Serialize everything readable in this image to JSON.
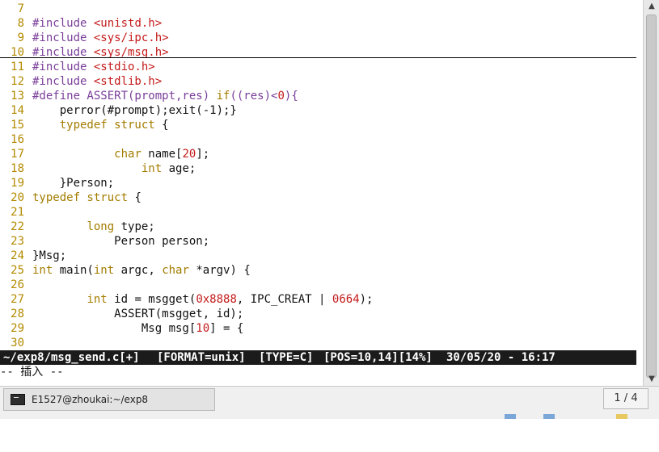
{
  "editor": {
    "lines": [
      {
        "num": "7",
        "segs": []
      },
      {
        "num": "8",
        "segs": [
          {
            "t": "#include ",
            "c": "pp"
          },
          {
            "t": "<",
            "c": "str"
          },
          {
            "t": "unistd.h",
            "c": "str"
          },
          {
            "t": ">",
            "c": "str"
          }
        ]
      },
      {
        "num": "9",
        "segs": [
          {
            "t": "#include ",
            "c": "pp"
          },
          {
            "t": "<sys/ipc.h>",
            "c": "str"
          }
        ]
      },
      {
        "num": "10",
        "segs": [
          {
            "t": "#include ",
            "c": "pp"
          },
          {
            "t": "<sys/msg.h>",
            "c": "str"
          }
        ]
      },
      {
        "num": "11",
        "segs": [
          {
            "t": "#include ",
            "c": "pp"
          },
          {
            "t": "<stdio.h>",
            "c": "str"
          }
        ]
      },
      {
        "num": "12",
        "segs": [
          {
            "t": "#include ",
            "c": "pp"
          },
          {
            "t": "<stdlib.h>",
            "c": "str"
          }
        ]
      },
      {
        "num": "13",
        "segs": [
          {
            "t": "#define ASSERT(prompt,res) ",
            "c": "pp"
          },
          {
            "t": "if",
            "c": "kw"
          },
          {
            "t": "((res)<",
            "c": "pp"
          },
          {
            "t": "0",
            "c": "num"
          },
          {
            "t": "){",
            "c": "pp"
          }
        ]
      },
      {
        "num": "14",
        "segs": [
          {
            "t": "    perror(#prompt);exit(-1);}",
            "c": "op"
          }
        ]
      },
      {
        "num": "15",
        "segs": [
          {
            "t": "    ",
            "c": "op"
          },
          {
            "t": "typedef struct",
            "c": "kw"
          },
          {
            "t": " {",
            "c": "op"
          }
        ]
      },
      {
        "num": "16",
        "segs": []
      },
      {
        "num": "17",
        "segs": [
          {
            "t": "            ",
            "c": "op"
          },
          {
            "t": "char",
            "c": "kw"
          },
          {
            "t": " name[",
            "c": "op"
          },
          {
            "t": "20",
            "c": "num"
          },
          {
            "t": "];",
            "c": "op"
          }
        ]
      },
      {
        "num": "18",
        "segs": [
          {
            "t": "                ",
            "c": "op"
          },
          {
            "t": "int",
            "c": "kw"
          },
          {
            "t": " age;",
            "c": "op"
          }
        ]
      },
      {
        "num": "19",
        "segs": [
          {
            "t": "    }Person;",
            "c": "op"
          }
        ]
      },
      {
        "num": "20",
        "segs": [
          {
            "t": "typedef struct",
            "c": "kw"
          },
          {
            "t": " {",
            "c": "op"
          }
        ]
      },
      {
        "num": "21",
        "segs": []
      },
      {
        "num": "22",
        "segs": [
          {
            "t": "        ",
            "c": "op"
          },
          {
            "t": "long",
            "c": "kw"
          },
          {
            "t": " type;",
            "c": "op"
          }
        ]
      },
      {
        "num": "23",
        "segs": [
          {
            "t": "            Person person;",
            "c": "op"
          }
        ]
      },
      {
        "num": "24",
        "segs": [
          {
            "t": "}Msg;",
            "c": "op"
          }
        ]
      },
      {
        "num": "25",
        "segs": [
          {
            "t": "int",
            "c": "kw"
          },
          {
            "t": " main(",
            "c": "op"
          },
          {
            "t": "int",
            "c": "kw"
          },
          {
            "t": " argc, ",
            "c": "op"
          },
          {
            "t": "char",
            "c": "kw"
          },
          {
            "t": " *argv) {",
            "c": "op"
          }
        ]
      },
      {
        "num": "26",
        "segs": []
      },
      {
        "num": "27",
        "segs": [
          {
            "t": "        ",
            "c": "op"
          },
          {
            "t": "int",
            "c": "kw"
          },
          {
            "t": " id = msgget(",
            "c": "op"
          },
          {
            "t": "0x8888",
            "c": "num"
          },
          {
            "t": ", IPC_CREAT | ",
            "c": "op"
          },
          {
            "t": "0664",
            "c": "num"
          },
          {
            "t": ");",
            "c": "op"
          }
        ]
      },
      {
        "num": "28",
        "segs": [
          {
            "t": "            ASSERT(msgget, id);",
            "c": "op"
          }
        ]
      },
      {
        "num": "29",
        "segs": [
          {
            "t": "                Msg msg[",
            "c": "op"
          },
          {
            "t": "10",
            "c": "num"
          },
          {
            "t": "] = {",
            "c": "op"
          }
        ]
      },
      {
        "num": "30",
        "segs": []
      }
    ]
  },
  "statusbar": {
    "file": "~/exp8/msg_send.c[+]",
    "format": "[FORMAT=unix]",
    "type": "[TYPE=C]",
    "pos": "[POS=10,14][14%]",
    "datetime": "30/05/20 - 16:17"
  },
  "mode": "-- 插入 --",
  "taskbar": {
    "task_label": "E1527@zhoukai:~/exp8",
    "pager": "1 / 4"
  },
  "colors": {
    "keyword": "#a37c00",
    "preprocessor": "#7a3e99",
    "string": "#c41a1a",
    "line_number": "#b38a00",
    "statusbar_bg": "#1b1b1b"
  },
  "icons": [
    "terminal-icon",
    "scroll-up-icon",
    "scroll-down-icon"
  ]
}
